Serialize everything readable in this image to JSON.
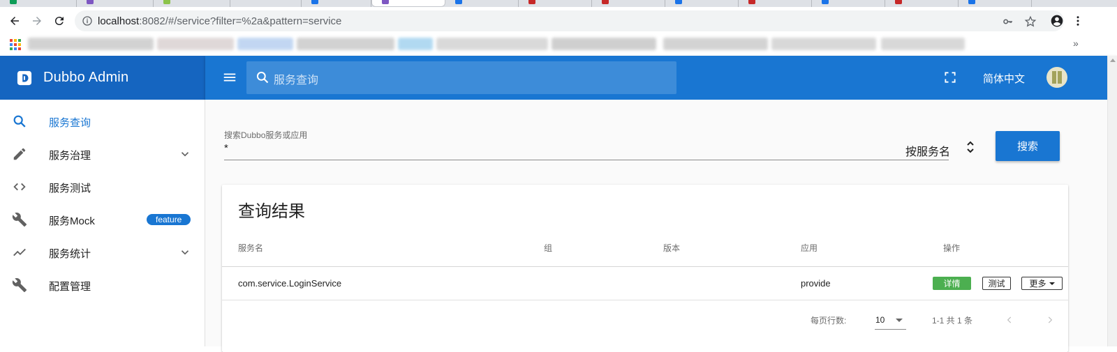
{
  "browser": {
    "url_host": "localhost",
    "url_rest": ":8082/#/service?filter=%2a&pattern=service"
  },
  "app": {
    "title": "Dubbo Admin",
    "search_placeholder": "服务查询",
    "language": "简体中文"
  },
  "sidebar": {
    "items": [
      {
        "label": "服务查询",
        "icon": "search-icon",
        "active": true
      },
      {
        "label": "服务治理",
        "icon": "pencil-icon",
        "expandable": true
      },
      {
        "label": "服务测试",
        "icon": "code-icon"
      },
      {
        "label": "服务Mock",
        "icon": "wrench-icon",
        "badge": "feature"
      },
      {
        "label": "服务统计",
        "icon": "trending-icon",
        "expandable": true
      },
      {
        "label": "配置管理",
        "icon": "wrench-icon"
      }
    ]
  },
  "search_form": {
    "label": "搜索Dubbo服务或应用",
    "value": "*",
    "mode": "按服务名",
    "button": "搜索"
  },
  "results": {
    "title": "查询结果",
    "columns": [
      "服务名",
      "组",
      "版本",
      "应用",
      "操作"
    ],
    "rows": [
      {
        "service": "com.service.LoginService",
        "group": "",
        "version": "",
        "application": "provide"
      }
    ],
    "actions": {
      "detail": "详情",
      "test": "测试",
      "more": "更多"
    },
    "pagination": {
      "rows_per_page_label": "每页行数:",
      "rows_per_page": "10",
      "range": "1-1 共 1 条"
    }
  },
  "colors": {
    "primary": "#1976d2",
    "brand_dark": "#1565c0",
    "success": "#4caf50"
  }
}
